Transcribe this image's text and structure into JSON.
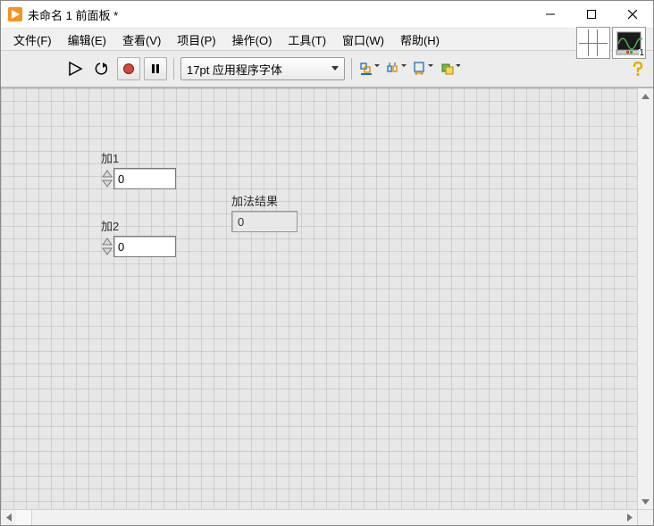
{
  "title": "未命名 1 前面板 *",
  "menu": {
    "file": "文件(F)",
    "edit": "编辑(E)",
    "view": "查看(V)",
    "project": "项目(P)",
    "operate": "操作(O)",
    "tools": "工具(T)",
    "window": "窗口(W)",
    "help": "帮助(H)"
  },
  "toolbar": {
    "font_label": "17pt 应用程序字体"
  },
  "panel_icon_index": "1",
  "controls": {
    "add1": {
      "label": "加1",
      "value": "0"
    },
    "add2": {
      "label": "加2",
      "value": "0"
    },
    "result": {
      "label": "加法结果",
      "value": "0"
    }
  }
}
